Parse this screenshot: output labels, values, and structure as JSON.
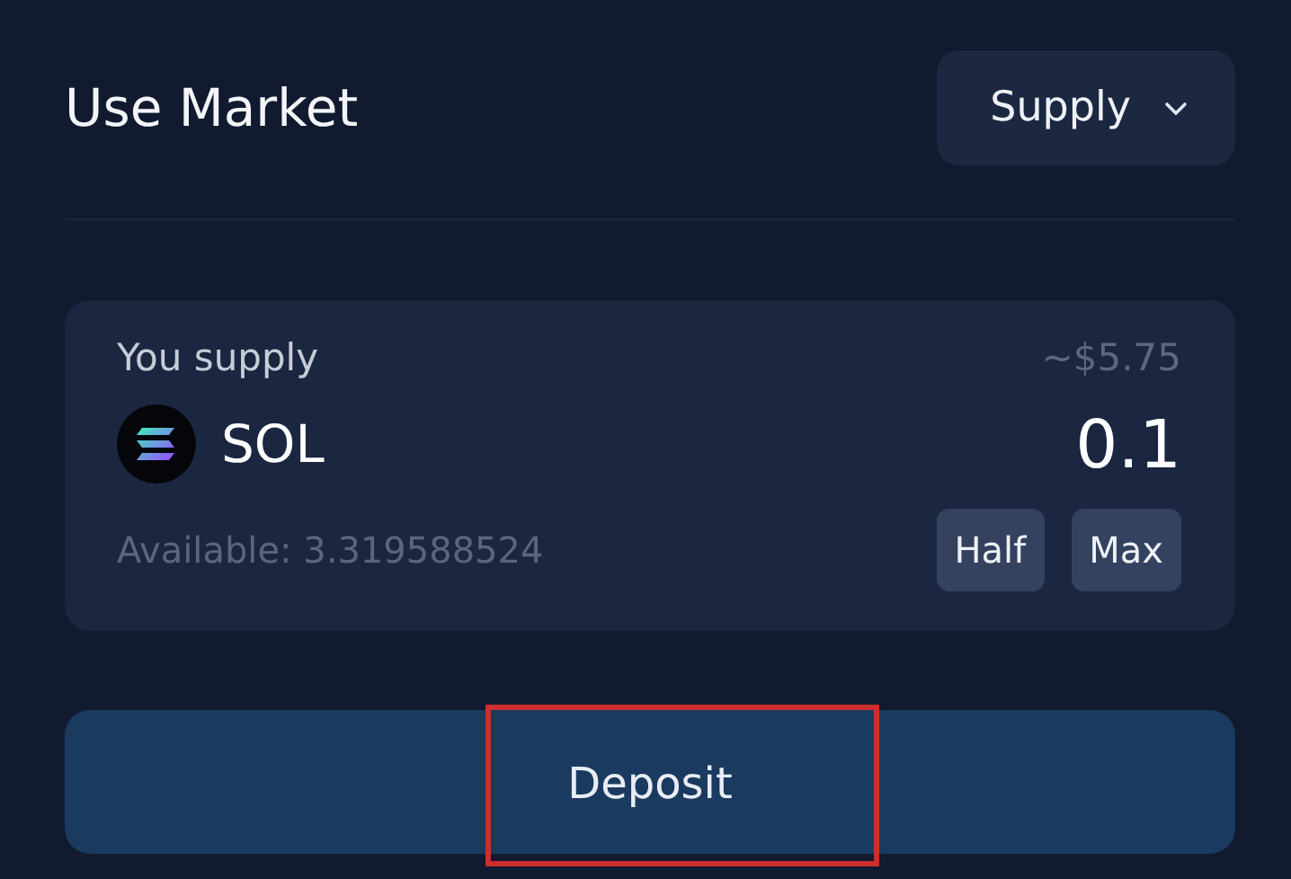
{
  "header": {
    "title": "Use Market",
    "mode_dropdown": "Supply"
  },
  "supply_card": {
    "label": "You supply",
    "usd_value": "~$5.75",
    "token": "SOL",
    "amount": "0.1",
    "available": "Available: 3.319588524",
    "quick_buttons": [
      "Half",
      "Max"
    ]
  },
  "action_button": {
    "label": "Deposit",
    "highlighted": true
  }
}
